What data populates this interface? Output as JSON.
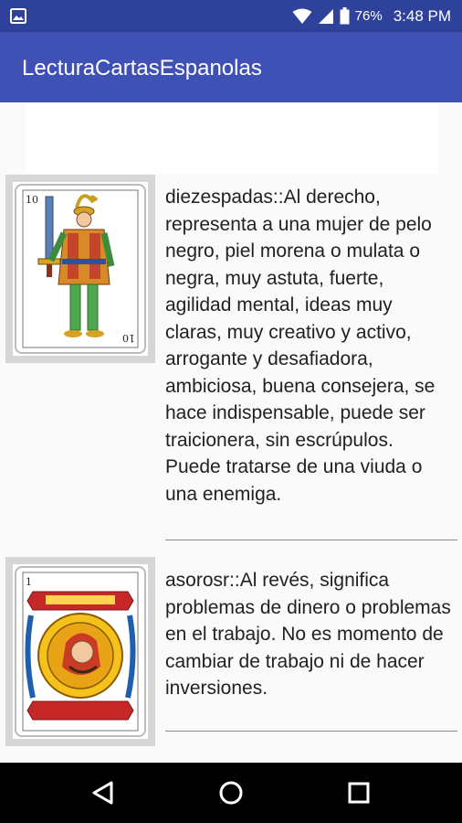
{
  "status_bar": {
    "battery_percent": "76%",
    "time": "3:48 PM",
    "icons": [
      "image-icon",
      "wifi-icon",
      "signal-icon",
      "battery-icon"
    ]
  },
  "app_bar": {
    "title": "LecturaCartasEspanolas",
    "color": "#3f51b5"
  },
  "cards": [
    {
      "image": "ten-of-swords-card",
      "card_number": "10",
      "text": "diezespadas::Al derecho, representa a una mujer de pelo negro, piel morena o mulata o negra, muy astuta, fuerte, agilidad mental, ideas muy claras, muy creativo y activo, arrogante y desafiadora, ambiciosa, buena consejera, se hace indispensable, puede ser traicionera, sin escrúpulos. Puede tratarse de una viuda o una enemiga."
    },
    {
      "image": "ace-of-coins-card",
      "card_number": "1",
      "text": "asorosr::Al revés, significa problemas de dinero o problemas en el trabajo. No es momento de cambiar de trabajo ni de hacer inversiones."
    }
  ],
  "nav_bar": {
    "icons": [
      "back-icon",
      "home-icon",
      "recents-icon"
    ]
  }
}
